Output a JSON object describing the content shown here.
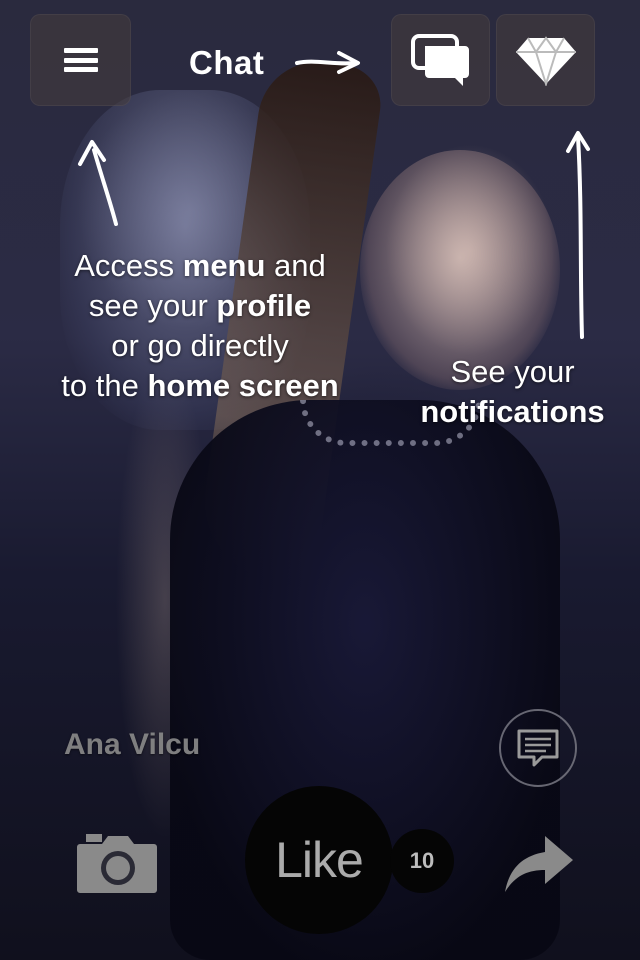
{
  "header": {
    "menu_icon": "hamburger-menu-icon",
    "chat_label": "Chat",
    "chat_icon": "chat-bubbles-icon",
    "notifications_icon": "diamond-icon"
  },
  "annotations": {
    "menu_help_lines": [
      {
        "parts": [
          {
            "text": "Access ",
            "bold": false
          },
          {
            "text": "menu",
            "bold": true
          },
          {
            "text": " and",
            "bold": false
          }
        ]
      },
      {
        "parts": [
          {
            "text": "see your ",
            "bold": false
          },
          {
            "text": "profile",
            "bold": true
          }
        ]
      },
      {
        "parts": [
          {
            "text": "or go directly",
            "bold": false
          }
        ]
      },
      {
        "parts": [
          {
            "text": "to the ",
            "bold": false
          },
          {
            "text": "home screen",
            "bold": true
          }
        ]
      }
    ],
    "notif_help_line1": "See your",
    "notif_help_line2": "notifications"
  },
  "post": {
    "user_name": "Ana Vilcu",
    "like_label": "Like",
    "like_count": "10"
  },
  "footer": {
    "camera_icon": "camera-icon",
    "comment_icon": "comment-icon",
    "share_icon": "share-arrow-icon"
  },
  "colors": {
    "text": "#ffffff",
    "like_bg": "#050505",
    "muted": "#8c8c8c"
  }
}
